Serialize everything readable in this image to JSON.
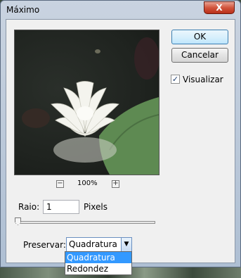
{
  "window": {
    "title": "Máximo",
    "close_label": "X"
  },
  "buttons": {
    "ok": "OK",
    "cancel": "Cancelar"
  },
  "visualizar": {
    "label": "Visualizar",
    "checked": true,
    "check_glyph": "✓"
  },
  "zoom": {
    "level": "100%",
    "minus": "−",
    "plus": "+"
  },
  "raio": {
    "label": "Raio:",
    "value": "1",
    "unit": "Pixels",
    "slider_fraction": 0.0
  },
  "preservar": {
    "label": "Preservar:",
    "selected": "Quadratura",
    "options": [
      "Quadratura",
      "Redondez"
    ],
    "highlighted_index": 0
  },
  "icons": {
    "dropdown_arrow": "chevron-down-icon",
    "close": "close-icon"
  }
}
